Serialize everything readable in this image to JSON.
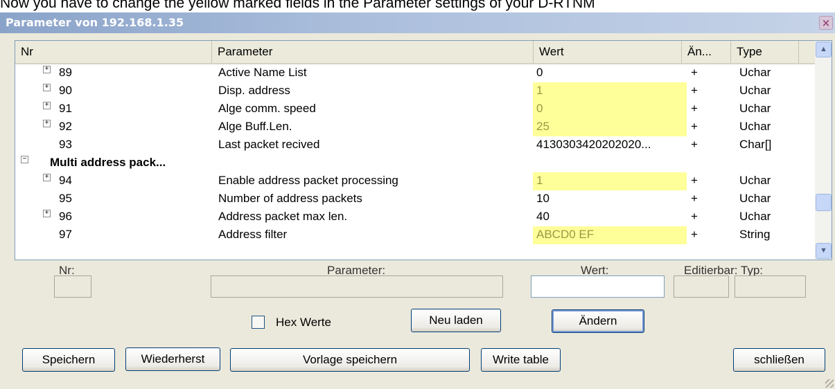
{
  "caption": "Now you have to change the yellow marked fields in the Parameter settings of your D-RTNM",
  "window": {
    "title": "Parameter von 192.168.1.35",
    "close_label": "×"
  },
  "table": {
    "headers": [
      "Nr",
      "Parameter",
      "Wert",
      "Än...",
      "Type"
    ],
    "rows": [
      {
        "nr": "89",
        "parameter": "Active Name List",
        "wert": "0",
        "an": "+",
        "type": "Uchar"
      },
      {
        "nr": "90",
        "parameter": "Disp. address",
        "wert": "1",
        "an": "+",
        "type": "Uchar"
      },
      {
        "nr": "91",
        "parameter": "Alge comm. speed",
        "wert": "0",
        "an": "+",
        "type": "Uchar"
      },
      {
        "nr": "92",
        "parameter": "Alge Buff.Len.",
        "wert": "25",
        "an": "+",
        "type": "Uchar"
      },
      {
        "nr": "93",
        "parameter": "Last packet recived",
        "wert": "4130303420202020...",
        "an": "+",
        "type": "Char[]"
      },
      {
        "group": "Multi address pack..."
      },
      {
        "nr": "94",
        "parameter": "Enable address packet processing",
        "wert": "1",
        "an": "+",
        "type": "Uchar"
      },
      {
        "nr": "95",
        "parameter": "Number of address packets",
        "wert": "10",
        "an": "+",
        "type": "Uchar"
      },
      {
        "nr": "96",
        "parameter": "Address packet max len.",
        "wert": "40",
        "an": "+",
        "type": "Uchar"
      },
      {
        "nr": "97",
        "parameter": "Address filter",
        "wert": "ABCD0 EF",
        "an": "+",
        "type": "String"
      }
    ]
  },
  "form": {
    "nr_label": "Nr:",
    "parameter_label": "Parameter:",
    "wert_label": "Wert:",
    "editierbar_typ_label": "Editierbar: Typ:",
    "hex_label": "Hex Werte"
  },
  "buttons": {
    "neu_laden": "Neu laden",
    "andern": "Ändern",
    "speichern": "Speichern",
    "wiederherst": "Wiederherst",
    "vorlage_speichern": "Vorlage speichern",
    "write_table": "Write table",
    "schliessen": "schließen"
  },
  "colors": {
    "highlight": "#ffff99",
    "titlebar": "#a9bddb"
  }
}
